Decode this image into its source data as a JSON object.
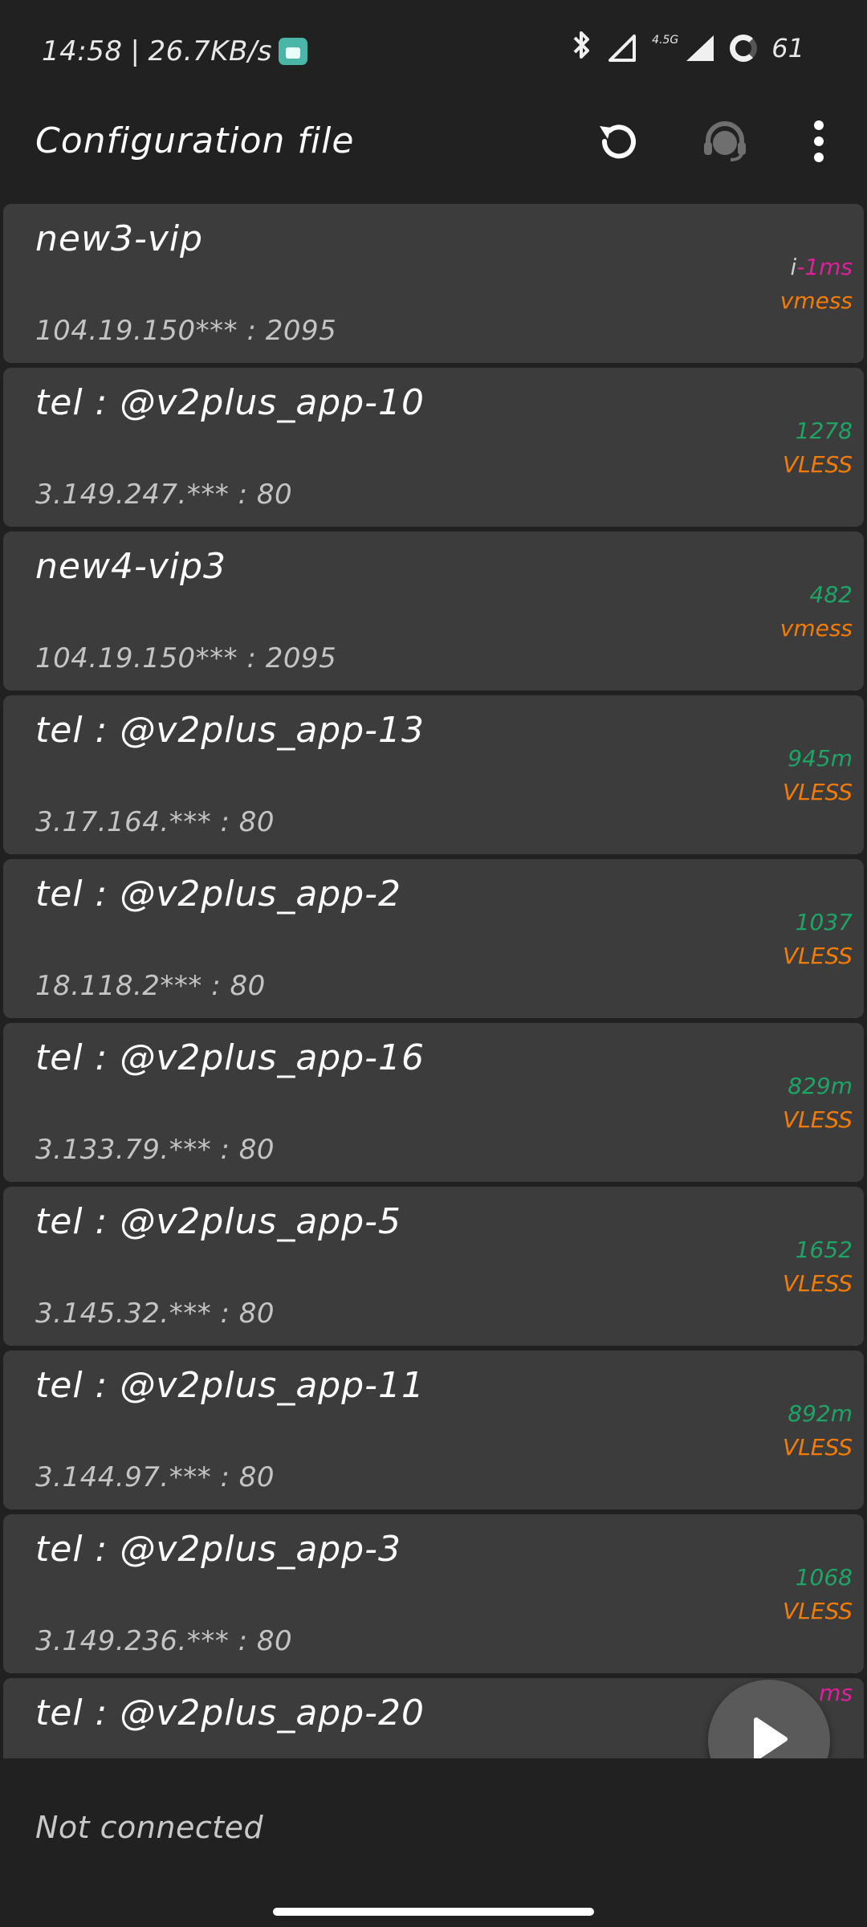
{
  "status_bar": {
    "time": "14:58",
    "separator": "|",
    "speed": "26.7KB/s",
    "network_type": "4.5G",
    "battery": "61"
  },
  "app_bar": {
    "title": "Configuration file"
  },
  "servers": [
    {
      "name": "new3-vip",
      "address": "104.19.150*** : 2095",
      "latency_prefix": "i",
      "latency": "-1ms",
      "latency_error": true,
      "type": "vmess"
    },
    {
      "name": "tel : @v2plus_app-10",
      "address": "3.149.247.*** : 80",
      "latency_prefix": "",
      "latency": "1278",
      "latency_error": false,
      "type": "VLESS"
    },
    {
      "name": "new4-vip3",
      "address": "104.19.150*** : 2095",
      "latency_prefix": "",
      "latency": "482",
      "latency_error": false,
      "type": "vmess"
    },
    {
      "name": "tel : @v2plus_app-13",
      "address": "3.17.164.*** : 80",
      "latency_prefix": "",
      "latency": "945m",
      "latency_error": false,
      "type": "VLESS"
    },
    {
      "name": "tel : @v2plus_app-2",
      "address": "18.118.2*** : 80",
      "latency_prefix": "",
      "latency": "1037",
      "latency_error": false,
      "type": "VLESS"
    },
    {
      "name": "tel : @v2plus_app-16",
      "address": "3.133.79.*** : 80",
      "latency_prefix": "",
      "latency": "829m",
      "latency_error": false,
      "type": "VLESS"
    },
    {
      "name": "tel : @v2plus_app-5",
      "address": "3.145.32.*** : 80",
      "latency_prefix": "",
      "latency": "1652",
      "latency_error": false,
      "type": "VLESS"
    },
    {
      "name": "tel : @v2plus_app-11",
      "address": "3.144.97.*** : 80",
      "latency_prefix": "",
      "latency": "892m",
      "latency_error": false,
      "type": "VLESS"
    },
    {
      "name": "tel : @v2plus_app-3",
      "address": "3.149.236.*** : 80",
      "latency_prefix": "",
      "latency": "1068",
      "latency_error": false,
      "type": "VLESS"
    },
    {
      "name": "tel : @v2plus_app-20",
      "address": "",
      "latency_prefix": "",
      "latency": "ms",
      "latency_error": true,
      "type": ""
    }
  ],
  "footer": {
    "connection_status": "Not connected"
  },
  "colors": {
    "background": "#212121",
    "card": "#3c3c3c",
    "latency_ok": "#1ea566",
    "latency_error": "#e0209b",
    "protocol": "#f57c00"
  },
  "icons": {
    "refresh": "refresh-icon",
    "support": "support-headset-icon",
    "menu": "more-vertical-icon",
    "fab": "play-icon"
  }
}
